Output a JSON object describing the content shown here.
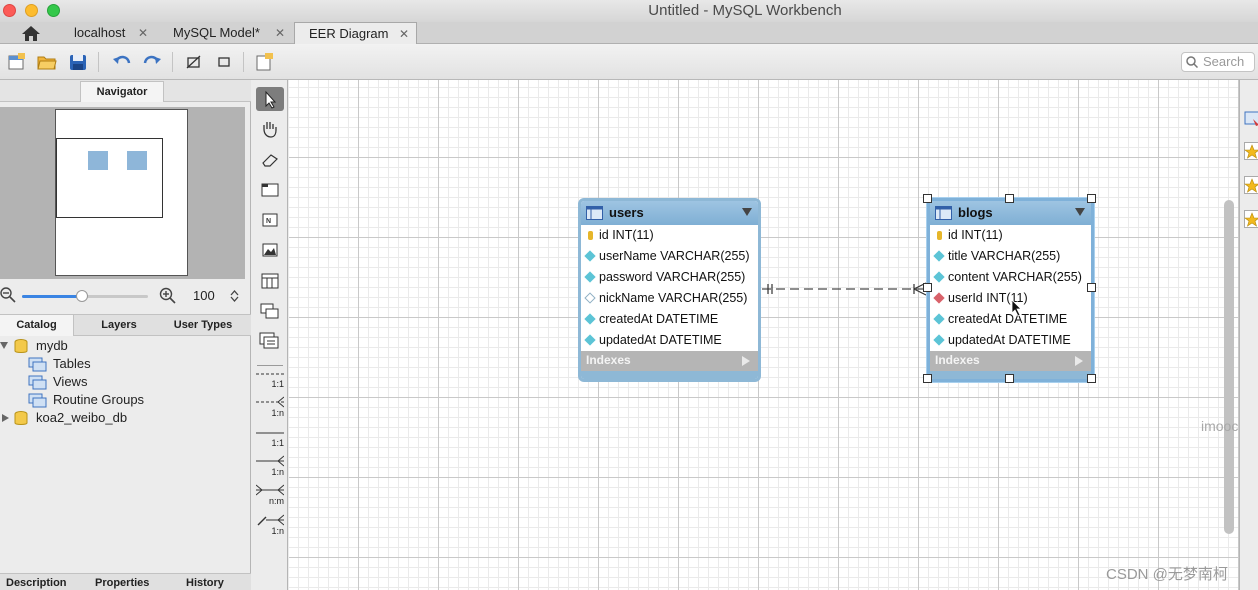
{
  "window": {
    "title": "Untitled - MySQL Workbench"
  },
  "tabs": [
    {
      "label": "localhost",
      "close": "✕"
    },
    {
      "label": "MySQL Model*",
      "close": "✕"
    },
    {
      "label": "EER Diagram",
      "close": "✕"
    }
  ],
  "toolbar": {
    "search_placeholder": "Search"
  },
  "navigator": {
    "tab_label": "Navigator",
    "zoom_value": "100",
    "zoom_level_fraction": 0.48
  },
  "catalog_tabs": [
    "Catalog",
    "Layers",
    "User Types"
  ],
  "tree": {
    "schemas": [
      {
        "name": "mydb",
        "expanded": true,
        "children": [
          "Tables",
          "Views",
          "Routine Groups"
        ]
      },
      {
        "name": "koa2_weibo_db",
        "expanded": false,
        "children": []
      }
    ]
  },
  "bottom_tabs": [
    "Description",
    "Properties",
    "History"
  ],
  "palette": {
    "relationship_labels": [
      "1:1",
      "1:n",
      "1:1",
      "1:n",
      "n:m",
      "1:n"
    ]
  },
  "tables": [
    {
      "name": "users",
      "columns": [
        {
          "text": "id INT(11)",
          "kind": "pk"
        },
        {
          "text": "userName VARCHAR(255)",
          "kind": "nn"
        },
        {
          "text": "password VARCHAR(255)",
          "kind": "nn"
        },
        {
          "text": "nickName VARCHAR(255)",
          "kind": "nullable"
        },
        {
          "text": "createdAt DATETIME",
          "kind": "nn"
        },
        {
          "text": "updatedAt DATETIME",
          "kind": "nn"
        }
      ],
      "indexes_label": "Indexes"
    },
    {
      "name": "blogs",
      "columns": [
        {
          "text": "id INT(11)",
          "kind": "pk"
        },
        {
          "text": "title VARCHAR(255)",
          "kind": "nn"
        },
        {
          "text": "content VARCHAR(255)",
          "kind": "nn"
        },
        {
          "text": "userId INT(11)",
          "kind": "fk"
        },
        {
          "text": "createdAt DATETIME",
          "kind": "nn"
        },
        {
          "text": "updatedAt DATETIME",
          "kind": "nn"
        }
      ],
      "indexes_label": "Indexes"
    }
  ],
  "watermarks": {
    "imooc": "imooc",
    "csdn": "CSDN @无梦南柯"
  },
  "colors": {
    "accent": "#3a84e3",
    "table_header": "#8eb8d6",
    "selected_tool": "#7d7d7d"
  }
}
